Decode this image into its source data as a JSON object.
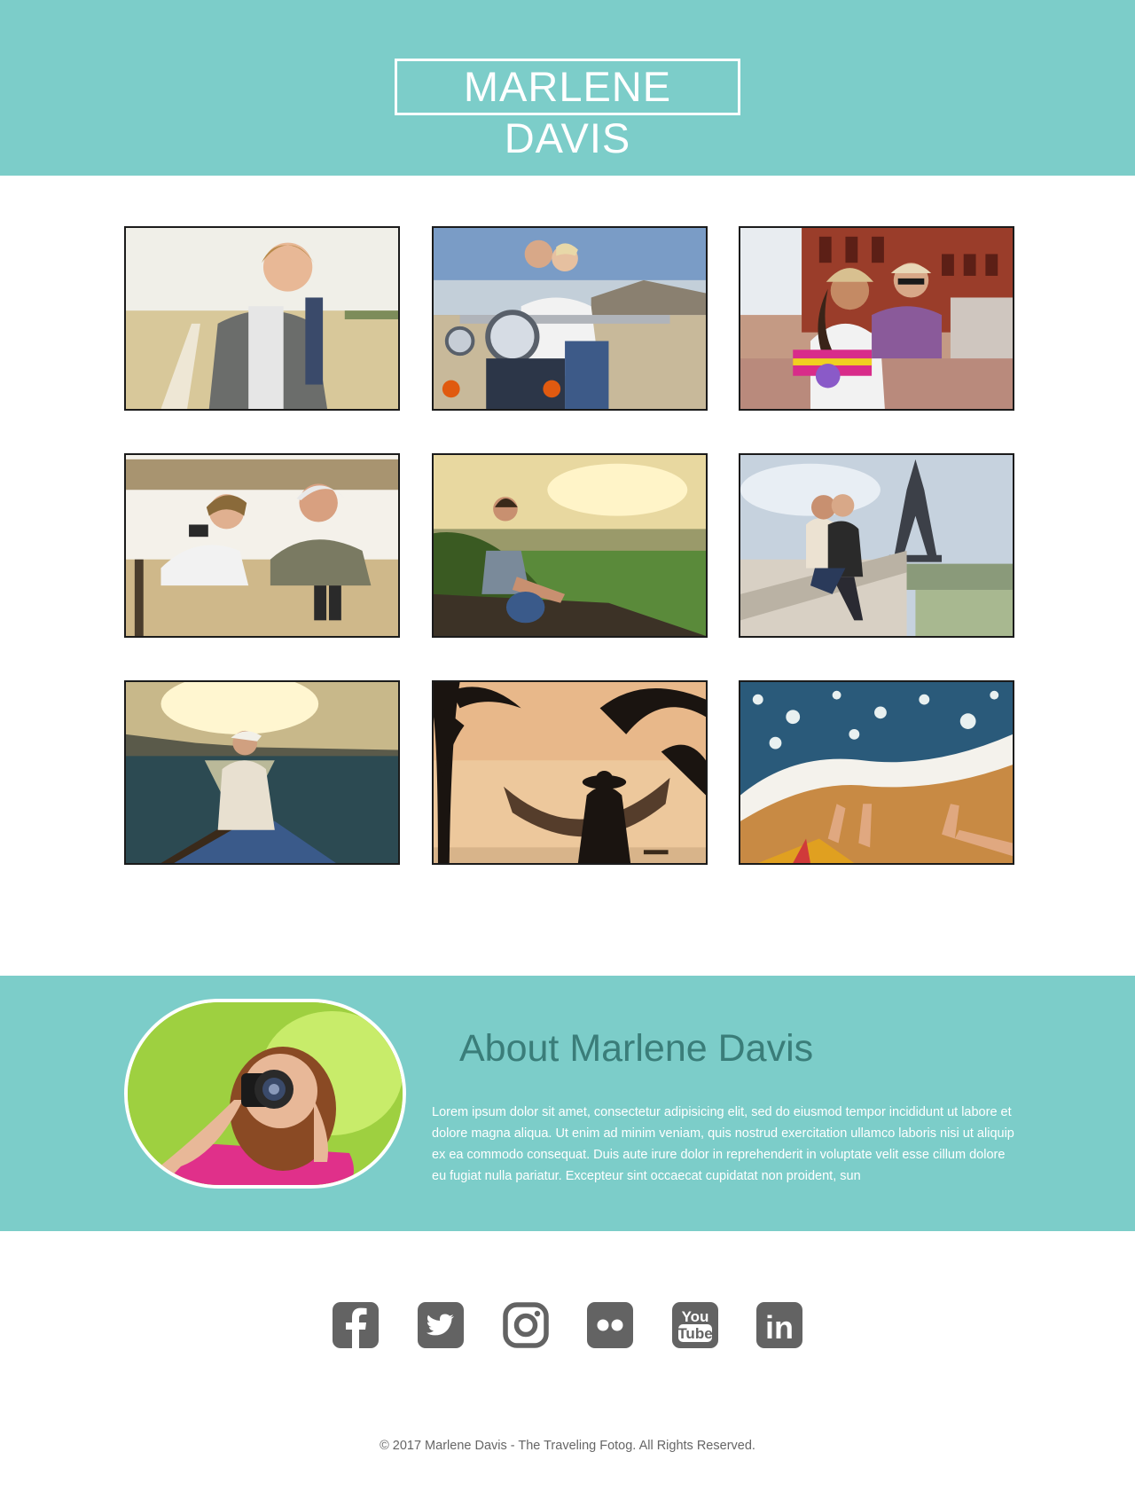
{
  "header": {
    "title": "MARLENE DAVIS",
    "background": "#7ccdc9"
  },
  "gallery": {
    "photos": [
      {
        "name": "backpacker-man"
      },
      {
        "name": "couple-motorcycle"
      },
      {
        "name": "couple-bicycles"
      },
      {
        "name": "couple-safari"
      },
      {
        "name": "woman-mountain-view"
      },
      {
        "name": "couple-eiffel-tower"
      },
      {
        "name": "woman-boat-sunset"
      },
      {
        "name": "hammock-sunset"
      },
      {
        "name": "feet-beach-waves"
      }
    ]
  },
  "about": {
    "title": "About Marlene Davis",
    "body": "Lorem ipsum dolor sit amet, consectetur adipisicing elit, sed do eiusmod tempor incididunt ut labore et dolore magna aliqua. Ut enim ad minim veniam, quis nostrud exercitation ullamco laboris nisi ut aliquip ex ea commodo consequat. Duis aute irure dolor in reprehenderit in voluptate velit esse cillum dolore eu fugiat nulla pariatur. Excepteur sint occaecat cupidatat non proident, sun",
    "title_color": "#3a7d79"
  },
  "social": [
    {
      "icon": "facebook-icon"
    },
    {
      "icon": "twitter-icon"
    },
    {
      "icon": "instagram-icon"
    },
    {
      "icon": "flickr-icon"
    },
    {
      "icon": "youtube-icon",
      "label_top": "You",
      "label_bottom": "Tube"
    },
    {
      "icon": "linkedin-icon",
      "label": "in"
    }
  ],
  "footer": {
    "copyright": "© 2017 Marlene Davis - The Traveling Fotog. All Rights Reserved."
  }
}
